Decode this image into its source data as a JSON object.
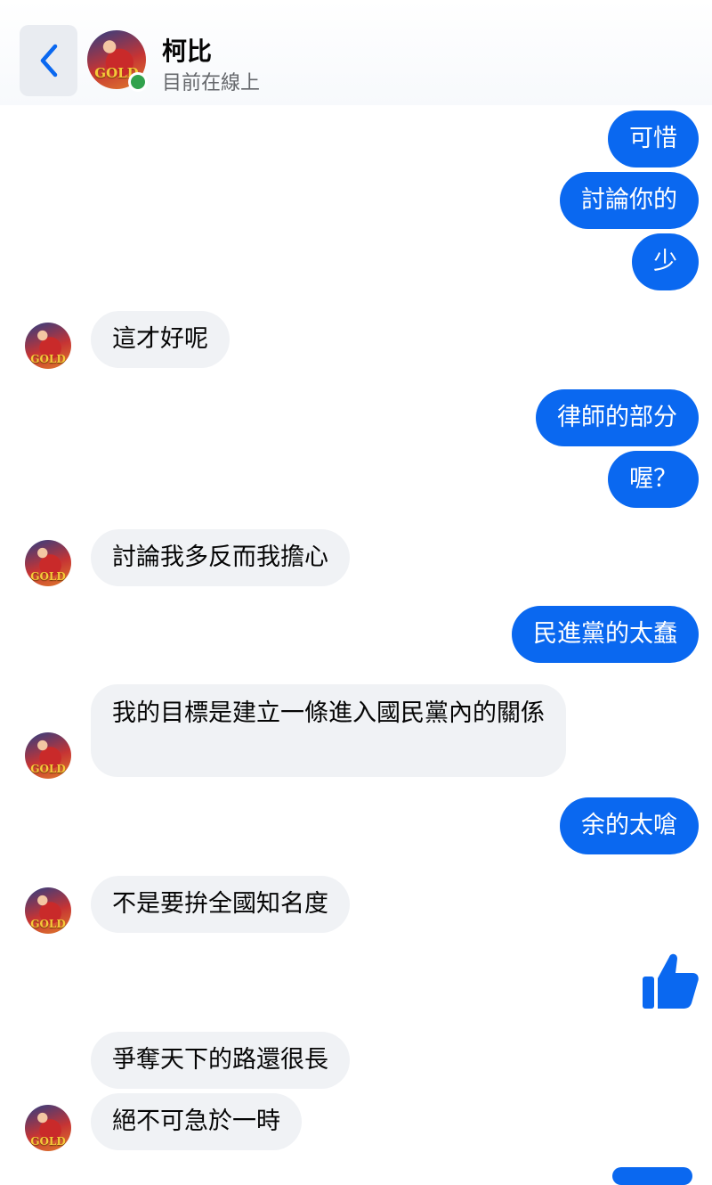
{
  "header": {
    "contact_name": "柯比",
    "status": "目前在線上",
    "avatar_text": "GOLD"
  },
  "messages": {
    "m1": "可惜",
    "m2": "討論你的",
    "m3": "少",
    "m4": "這才好呢",
    "m5": "律師的部分",
    "m6": "喔？",
    "m7": "討論我多反而我擔心",
    "m8": "民進黨的太蠢",
    "m9": "我的目標是建立一條進入國民黨內的關係",
    "m10": "余的太嗆",
    "m11": "不是要拚全國知名度",
    "m12": "爭奪天下的路還很長",
    "m13": "絕不可急於一時"
  },
  "icons": {
    "back": "chevron-left-icon",
    "like": "thumbs-up-icon"
  },
  "colors": {
    "accent": "#0a68f0",
    "incoming_bubble": "#f0f2f5",
    "online": "#31a24c"
  }
}
